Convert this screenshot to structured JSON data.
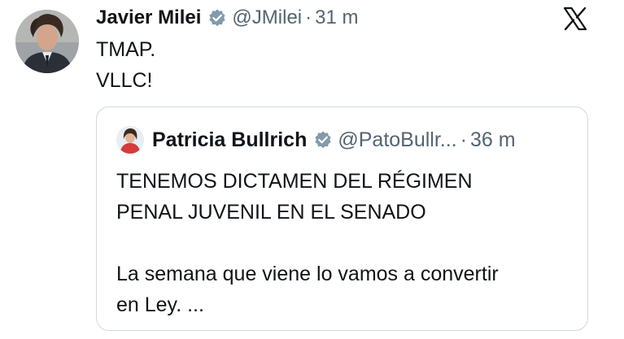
{
  "author": {
    "name": "Javier Milei",
    "handle": "@JMilei",
    "separator": "·",
    "time": "31 m"
  },
  "tweet": {
    "lines": [
      "TMAP.",
      "VLLC!"
    ]
  },
  "quoted": {
    "name": "Patricia Bullrich",
    "handle": "@PatoBullr...",
    "separator": "·",
    "time": "36 m",
    "lines": [
      "TENEMOS DICTAMEN DEL RÉGIMEN",
      "PENAL JUVENIL EN EL SENADO",
      "La semana que viene lo vamos a convertir",
      "en Ley. ..."
    ]
  },
  "colors": {
    "text": "#0f1419",
    "secondary": "#536471",
    "verified": "#829aab",
    "border": "#cfd9de"
  },
  "icons": {
    "verified": "verified-badge-icon",
    "platform": "x-logo-icon"
  }
}
